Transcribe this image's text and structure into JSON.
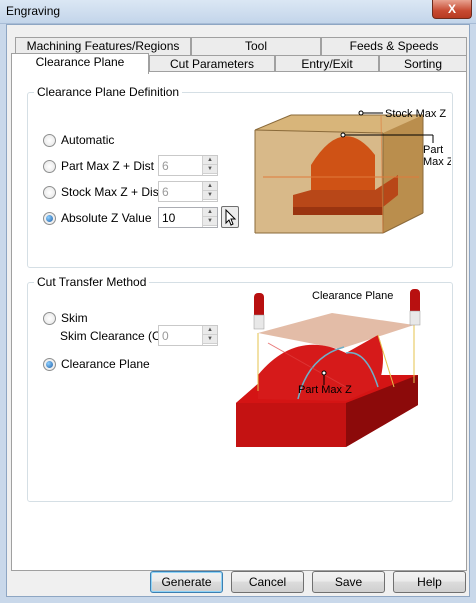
{
  "window": {
    "title": "Engraving",
    "close_glyph": "X"
  },
  "tabs": {
    "row1": [
      "Machining Features/Regions",
      "Tool",
      "Feeds & Speeds"
    ],
    "row2": [
      "Clearance Plane",
      "Cut Parameters",
      "Entry/Exit",
      "Sorting"
    ],
    "active": "Clearance Plane"
  },
  "definition": {
    "title": "Clearance Plane Definition",
    "options": [
      {
        "label": "Automatic",
        "checked": false
      },
      {
        "label": "Part Max Z + Dist",
        "checked": false,
        "value": "6",
        "disabled": true
      },
      {
        "label": "Stock Max Z + Dist",
        "checked": false,
        "value": "6",
        "disabled": true
      },
      {
        "label": "Absolute Z Value",
        "checked": true,
        "value": "10",
        "disabled": false
      }
    ],
    "diagram": {
      "label_stock": "Stock Max Z",
      "label_part_1": "Part",
      "label_part_2": "Max Z"
    }
  },
  "transfer": {
    "title": "Cut Transfer Method",
    "skim": {
      "label": "Skim",
      "checked": false
    },
    "skim_clearance": {
      "label": "Skim Clearance (C)",
      "value": "0",
      "disabled": true
    },
    "clearance_plane": {
      "label": "Clearance Plane",
      "checked": true
    },
    "diagram": {
      "label_plane": "Clearance Plane",
      "label_part": "Part Max Z"
    }
  },
  "buttons": {
    "generate": "Generate",
    "cancel": "Cancel",
    "save": "Save",
    "help": "Help"
  },
  "icons": {
    "radio": "radio-icon",
    "spin_up": "spin-up-icon",
    "spin_down": "spin-down-icon",
    "pick": "cursor-arrow-icon",
    "close": "close-icon"
  }
}
